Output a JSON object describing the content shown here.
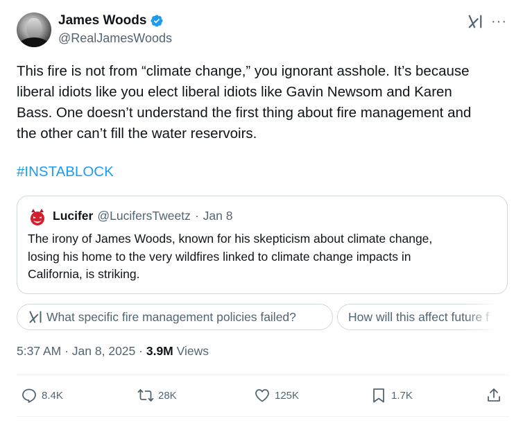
{
  "author": {
    "display_name": "James Woods",
    "handle": "@RealJamesWoods",
    "verified": true
  },
  "tweet": {
    "text": "This fire is not from “climate change,” you ignorant asshole. It’s because\nliberal idiots like you elect liberal idiots like Gavin Newsom and Karen\nBass. One doesn’t understand the first thing about fire management and\nthe other can’t fill the water reservoirs.",
    "hashtag": "#INSTABLOCK"
  },
  "quoted_tweet": {
    "display_name": "Lucifer",
    "handle": "@LucifersTweetz",
    "separator": "·",
    "date": "Jan 8",
    "text": "The irony of James Woods, known for his skepticism about climate change,\nlosing his home to the very wildfires linked to climate change impacts in\nCalifornia, is striking."
  },
  "grok_suggestions": [
    "What specific fire management policies failed?",
    "How will this affect future f"
  ],
  "meta": {
    "time": "5:37 AM",
    "separator": "·",
    "date": "Jan 8, 2025",
    "views_count": "3.9M",
    "views_label": "Views"
  },
  "actions": {
    "replies": "8.4K",
    "reposts": "28K",
    "likes": "125K",
    "bookmarks": "1.7K"
  },
  "colors": {
    "accent": "#1d9bf0",
    "text": "#0f1419",
    "muted": "#536471",
    "border": "#cfd9de"
  },
  "icons": [
    "verified-badge-icon",
    "grok-icon",
    "more-icon",
    "reply-icon",
    "repost-icon",
    "like-icon",
    "bookmark-icon",
    "share-icon"
  ]
}
